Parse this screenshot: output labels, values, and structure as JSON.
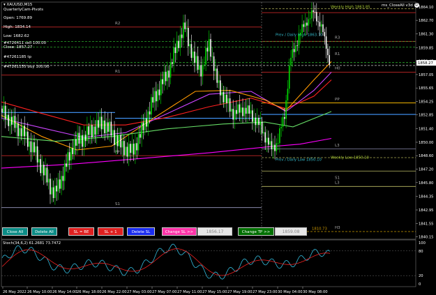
{
  "symbol": {
    "title": "XAUUSD,M15",
    "indicator": "QuarterlyCam-Pivots"
  },
  "info": {
    "open": "Open: 1769.89",
    "high": "High: 1834.14",
    "low": "Low: 1682.62",
    "close": "Close: 1857.27",
    "lines": [
      "#4726411 sell 100.00",
      "#47261185 tp",
      "#47261155 buy 100.00"
    ]
  },
  "ea": {
    "name": "ms_CloseAll v3d",
    "face": "☺"
  },
  "price_axis": {
    "ticks": [
      {
        "p": 1864.1,
        "t": "1864.10"
      },
      {
        "p": 1862.7,
        "t": "1862.70"
      },
      {
        "p": 1861.3,
        "t": "1861.30"
      },
      {
        "p": 1859.85,
        "t": "1859.85"
      },
      {
        "p": 1858.45,
        "t": "1858.45"
      },
      {
        "p": 1857.05,
        "t": "1857.05"
      },
      {
        "p": 1855.65,
        "t": "1855.65"
      },
      {
        "p": 1854.25,
        "t": "1854.25"
      },
      {
        "p": 1852.85,
        "t": "1852.85"
      },
      {
        "p": 1851.4,
        "t": "1851.40"
      },
      {
        "p": 1850.0,
        "t": "1850.00"
      },
      {
        "p": 1848.6,
        "t": "1848.60"
      },
      {
        "p": 1847.2,
        "t": "1847.20"
      },
      {
        "p": 1845.8,
        "t": "1845.80"
      },
      {
        "p": 1844.35,
        "t": "1844.35"
      },
      {
        "p": 1842.95,
        "t": "1842.95"
      },
      {
        "p": 1841.55,
        "t": "1841.55"
      },
      {
        "p": 1840.15,
        "t": "1840.15"
      }
    ],
    "current": "1858.27"
  },
  "time_axis": {
    "labels": [
      "26 May 2022",
      "26 May 10:00",
      "26 May 14:00",
      "26 May 18:00",
      "26 May 22:00",
      "27 May 03:00",
      "27 May 07:00",
      "27 May 11:00",
      "27 May 15:00",
      "27 May 19:00",
      "27 May 23:00",
      "30 May 04:00",
      "30 May 08:00"
    ]
  },
  "pivot_labels": [
    "R2",
    "R1",
    "PP",
    "S1",
    "R3",
    "R1",
    "H0",
    "PP",
    "L3",
    "S1",
    "L3",
    "H3"
  ],
  "annotations": {
    "weekly_high": "Weekly High 1863.85",
    "daily_high": "Prev / Daily High 1863.70",
    "daily_low": "Prev / Daily Low 1850.10",
    "weekly_low": "Weekly Low 1850.10",
    "bottom_level": "1810.73"
  },
  "buttons": {
    "close_all": "Close All",
    "delete_all": "Delete All",
    "sl_be": "SL = BE",
    "sl_plus": "SL + 1",
    "delete_sl": "Delete SL",
    "change_sl": "Change SL >>",
    "sl_value": "1856.17",
    "change_tp": "Change TP >>",
    "tp_value": "1859.08"
  },
  "oscillator": {
    "label": "Stoch(34,6,2) 61.2681 73.7472",
    "ticks": [
      "100",
      "80",
      "20",
      "0"
    ]
  },
  "colors": {
    "up": "#00e000",
    "down": "#ffffff",
    "ma_orange": "#ff9900",
    "ma_red": "#ff2020",
    "ma_purple": "#cc44ff",
    "ma_magenta": "#ff00ff",
    "ma_green": "#66dd66",
    "ma_blue": "#3399ff"
  }
}
